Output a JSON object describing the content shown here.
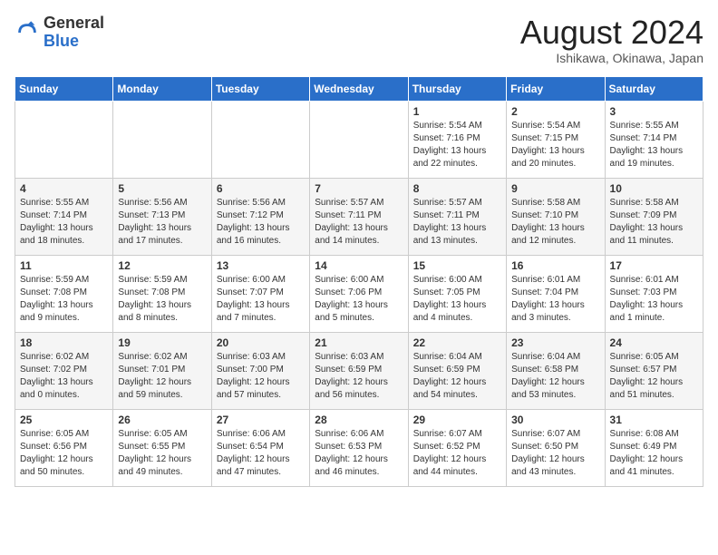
{
  "header": {
    "logo_general": "General",
    "logo_blue": "Blue",
    "month_title": "August 2024",
    "subtitle": "Ishikawa, Okinawa, Japan"
  },
  "weekdays": [
    "Sunday",
    "Monday",
    "Tuesday",
    "Wednesday",
    "Thursday",
    "Friday",
    "Saturday"
  ],
  "weeks": [
    [
      {
        "day": "",
        "info": ""
      },
      {
        "day": "",
        "info": ""
      },
      {
        "day": "",
        "info": ""
      },
      {
        "day": "",
        "info": ""
      },
      {
        "day": "1",
        "info": "Sunrise: 5:54 AM\nSunset: 7:16 PM\nDaylight: 13 hours\nand 22 minutes."
      },
      {
        "day": "2",
        "info": "Sunrise: 5:54 AM\nSunset: 7:15 PM\nDaylight: 13 hours\nand 20 minutes."
      },
      {
        "day": "3",
        "info": "Sunrise: 5:55 AM\nSunset: 7:14 PM\nDaylight: 13 hours\nand 19 minutes."
      }
    ],
    [
      {
        "day": "4",
        "info": "Sunrise: 5:55 AM\nSunset: 7:14 PM\nDaylight: 13 hours\nand 18 minutes."
      },
      {
        "day": "5",
        "info": "Sunrise: 5:56 AM\nSunset: 7:13 PM\nDaylight: 13 hours\nand 17 minutes."
      },
      {
        "day": "6",
        "info": "Sunrise: 5:56 AM\nSunset: 7:12 PM\nDaylight: 13 hours\nand 16 minutes."
      },
      {
        "day": "7",
        "info": "Sunrise: 5:57 AM\nSunset: 7:11 PM\nDaylight: 13 hours\nand 14 minutes."
      },
      {
        "day": "8",
        "info": "Sunrise: 5:57 AM\nSunset: 7:11 PM\nDaylight: 13 hours\nand 13 minutes."
      },
      {
        "day": "9",
        "info": "Sunrise: 5:58 AM\nSunset: 7:10 PM\nDaylight: 13 hours\nand 12 minutes."
      },
      {
        "day": "10",
        "info": "Sunrise: 5:58 AM\nSunset: 7:09 PM\nDaylight: 13 hours\nand 11 minutes."
      }
    ],
    [
      {
        "day": "11",
        "info": "Sunrise: 5:59 AM\nSunset: 7:08 PM\nDaylight: 13 hours\nand 9 minutes."
      },
      {
        "day": "12",
        "info": "Sunrise: 5:59 AM\nSunset: 7:08 PM\nDaylight: 13 hours\nand 8 minutes."
      },
      {
        "day": "13",
        "info": "Sunrise: 6:00 AM\nSunset: 7:07 PM\nDaylight: 13 hours\nand 7 minutes."
      },
      {
        "day": "14",
        "info": "Sunrise: 6:00 AM\nSunset: 7:06 PM\nDaylight: 13 hours\nand 5 minutes."
      },
      {
        "day": "15",
        "info": "Sunrise: 6:00 AM\nSunset: 7:05 PM\nDaylight: 13 hours\nand 4 minutes."
      },
      {
        "day": "16",
        "info": "Sunrise: 6:01 AM\nSunset: 7:04 PM\nDaylight: 13 hours\nand 3 minutes."
      },
      {
        "day": "17",
        "info": "Sunrise: 6:01 AM\nSunset: 7:03 PM\nDaylight: 13 hours\nand 1 minute."
      }
    ],
    [
      {
        "day": "18",
        "info": "Sunrise: 6:02 AM\nSunset: 7:02 PM\nDaylight: 13 hours\nand 0 minutes."
      },
      {
        "day": "19",
        "info": "Sunrise: 6:02 AM\nSunset: 7:01 PM\nDaylight: 12 hours\nand 59 minutes."
      },
      {
        "day": "20",
        "info": "Sunrise: 6:03 AM\nSunset: 7:00 PM\nDaylight: 12 hours\nand 57 minutes."
      },
      {
        "day": "21",
        "info": "Sunrise: 6:03 AM\nSunset: 6:59 PM\nDaylight: 12 hours\nand 56 minutes."
      },
      {
        "day": "22",
        "info": "Sunrise: 6:04 AM\nSunset: 6:59 PM\nDaylight: 12 hours\nand 54 minutes."
      },
      {
        "day": "23",
        "info": "Sunrise: 6:04 AM\nSunset: 6:58 PM\nDaylight: 12 hours\nand 53 minutes."
      },
      {
        "day": "24",
        "info": "Sunrise: 6:05 AM\nSunset: 6:57 PM\nDaylight: 12 hours\nand 51 minutes."
      }
    ],
    [
      {
        "day": "25",
        "info": "Sunrise: 6:05 AM\nSunset: 6:56 PM\nDaylight: 12 hours\nand 50 minutes."
      },
      {
        "day": "26",
        "info": "Sunrise: 6:05 AM\nSunset: 6:55 PM\nDaylight: 12 hours\nand 49 minutes."
      },
      {
        "day": "27",
        "info": "Sunrise: 6:06 AM\nSunset: 6:54 PM\nDaylight: 12 hours\nand 47 minutes."
      },
      {
        "day": "28",
        "info": "Sunrise: 6:06 AM\nSunset: 6:53 PM\nDaylight: 12 hours\nand 46 minutes."
      },
      {
        "day": "29",
        "info": "Sunrise: 6:07 AM\nSunset: 6:52 PM\nDaylight: 12 hours\nand 44 minutes."
      },
      {
        "day": "30",
        "info": "Sunrise: 6:07 AM\nSunset: 6:50 PM\nDaylight: 12 hours\nand 43 minutes."
      },
      {
        "day": "31",
        "info": "Sunrise: 6:08 AM\nSunset: 6:49 PM\nDaylight: 12 hours\nand 41 minutes."
      }
    ]
  ]
}
